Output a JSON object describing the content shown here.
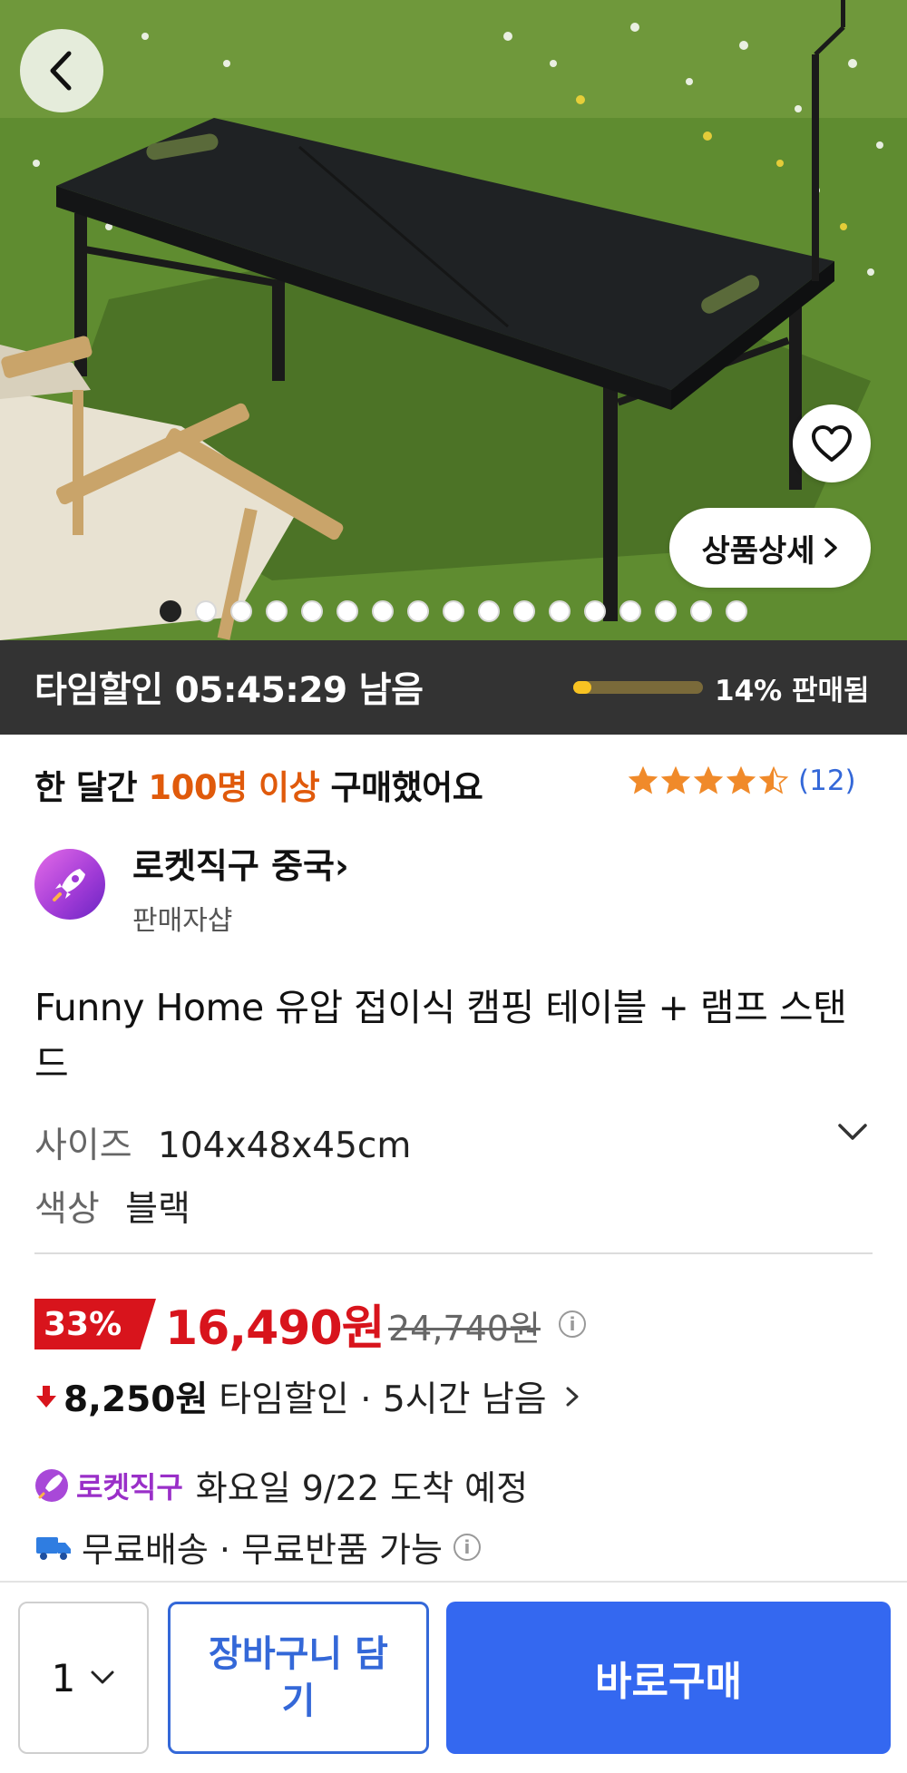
{
  "hero": {
    "detail_label": "상품상세",
    "slide_count": 17,
    "active_slide": 0
  },
  "timesale": {
    "label": "타임할인 05:45:29 남음",
    "sold_label": "14% 판매됨",
    "sold_fraction": 0.14
  },
  "purchase": {
    "prefix": "한 달간",
    "highlight": "100명 이상",
    "suffix": "구매했어요",
    "highlight_color": "#e05a0b"
  },
  "rating": {
    "stars": 4.5,
    "count": "(12)"
  },
  "seller": {
    "name": "로켓직구 중국",
    "arrow": "›",
    "sub": "판매자샵"
  },
  "product": {
    "title": "Funny Home 유압 접이식 캠핑 테이블 + 램프 스탠드",
    "options": [
      {
        "key": "사이즈",
        "value": "104x48x45cm"
      },
      {
        "key": "색상",
        "value": "블랙"
      }
    ]
  },
  "price": {
    "discount": "33%",
    "sale_price": "16,490원",
    "original_price": "24,740원",
    "timesale_amount": "8,250원",
    "timesale_text": "타임할인 · 5시간 남음",
    "price_color": "#d8141c"
  },
  "delivery": {
    "rocket_label": "로켓직구",
    "arrival": "화요일 9/22 도착 예정",
    "free_shipping": "무료배송 · 무료반품 가능"
  },
  "bottom_bar": {
    "quantity": "1",
    "cart_label": "장바구니 담기",
    "buy_label": "바로구매",
    "accent": "#3468f0"
  }
}
